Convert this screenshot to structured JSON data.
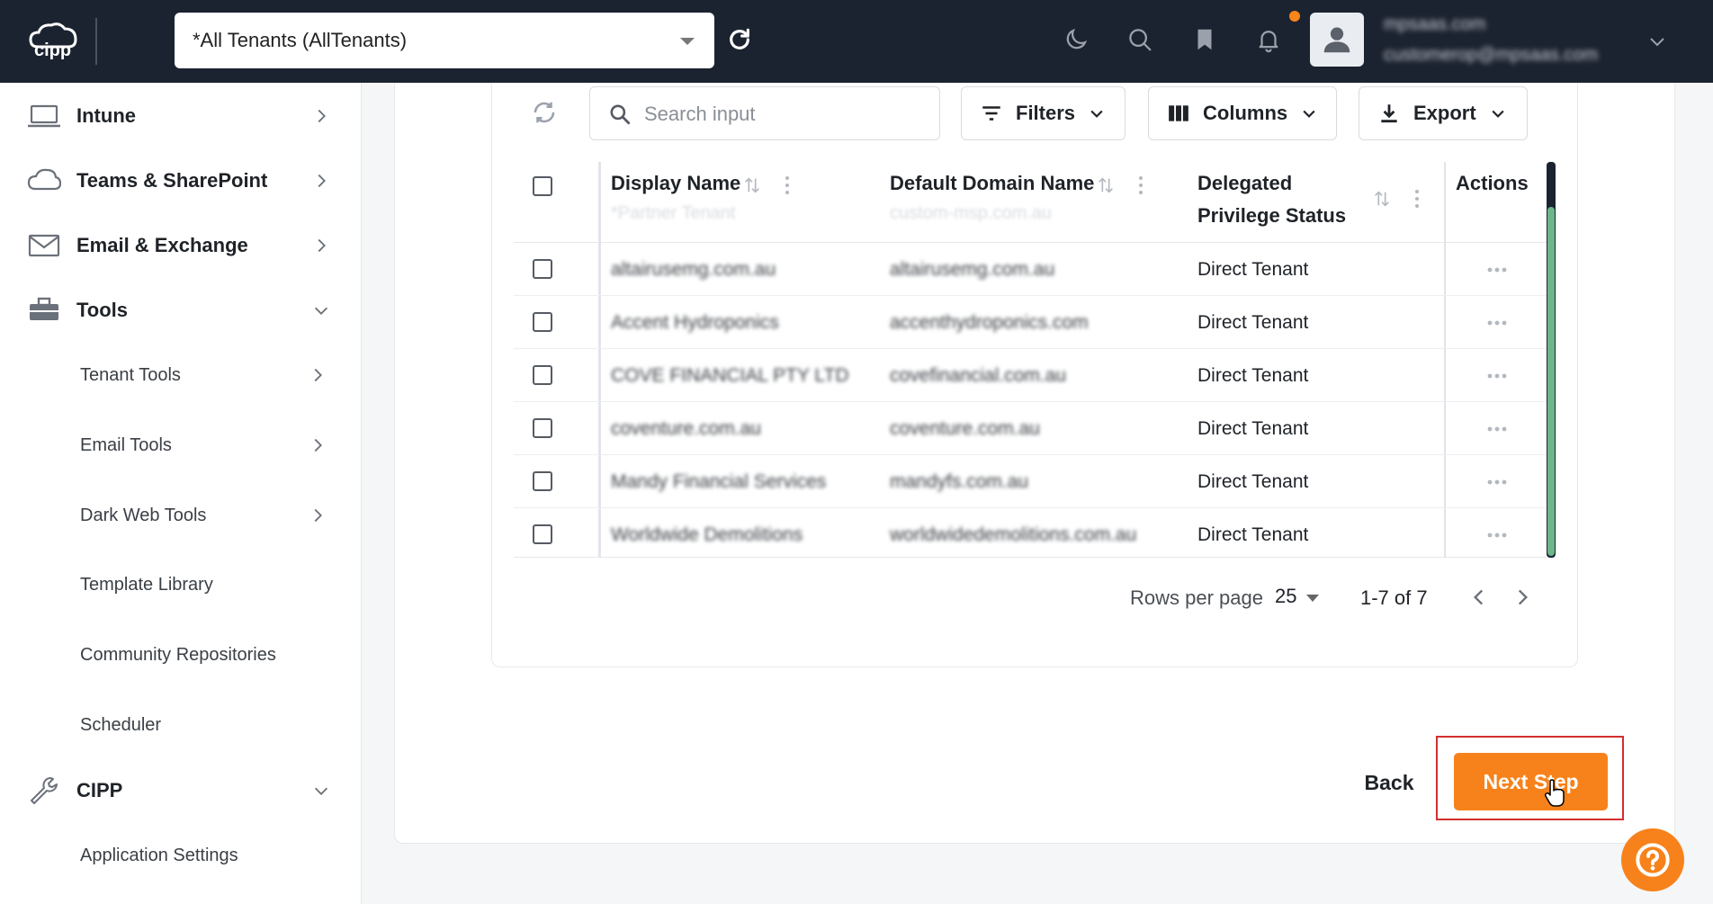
{
  "header": {
    "tenant_select_value": "*All Tenants (AllTenants)",
    "user_domain": "mpsaas.com",
    "user_email": "customerop@mpsaas.com"
  },
  "sidebar": {
    "items": [
      {
        "label": "Intune",
        "icon": "laptop-icon"
      },
      {
        "label": "Teams & SharePoint",
        "icon": "cloud-icon"
      },
      {
        "label": "Email & Exchange",
        "icon": "mail-icon"
      },
      {
        "label": "Tools",
        "icon": "toolbox-icon"
      },
      {
        "label": "Tenant Tools"
      },
      {
        "label": "Email Tools"
      },
      {
        "label": "Dark Web Tools"
      },
      {
        "label": "Template Library"
      },
      {
        "label": "Community Repositories"
      },
      {
        "label": "Scheduler"
      },
      {
        "label": "CIPP",
        "icon": "wrench-icon"
      },
      {
        "label": "Application Settings"
      }
    ]
  },
  "toolbar": {
    "search_placeholder": "Search input",
    "filters_label": "Filters",
    "columns_label": "Columns",
    "export_label": "Export"
  },
  "table": {
    "headers": {
      "display_name": "Display Name",
      "default_domain": "Default Domain Name",
      "delegated_line1": "Delegated",
      "delegated_line2": "Privilege Status",
      "actions": "Actions"
    },
    "ghost_row": {
      "display_name": "*Partner Tenant",
      "domain": "custom-msp.com.au"
    },
    "rows": [
      {
        "display_name": "altairusemg.com.au",
        "domain": "altairusemg.com.au",
        "status": "Direct Tenant"
      },
      {
        "display_name": "Accent Hydroponics",
        "domain": "accenthydroponics.com",
        "status": "Direct Tenant"
      },
      {
        "display_name": "COVE FINANCIAL PTY LTD",
        "domain": "covefinancial.com.au",
        "status": "Direct Tenant"
      },
      {
        "display_name": "coventure.com.au",
        "domain": "coventure.com.au",
        "status": "Direct Tenant"
      },
      {
        "display_name": "Mandy Financial Services",
        "domain": "mandyfs.com.au",
        "status": "Direct Tenant"
      },
      {
        "display_name": "Worldwide Demolitions",
        "domain": "worldwidedemolitions.com.au",
        "status": "Direct Tenant"
      }
    ]
  },
  "pagination": {
    "rows_per_page_label": "Rows per page",
    "rows_per_page_value": "25",
    "range": "1-7 of 7"
  },
  "footer": {
    "back_label": "Back",
    "next_label": "Next Step"
  },
  "colors": {
    "accent": "#f7821b",
    "topbar": "#1c2330",
    "scroll_thumb": "#6db58a",
    "highlight": "#d32f2f"
  }
}
